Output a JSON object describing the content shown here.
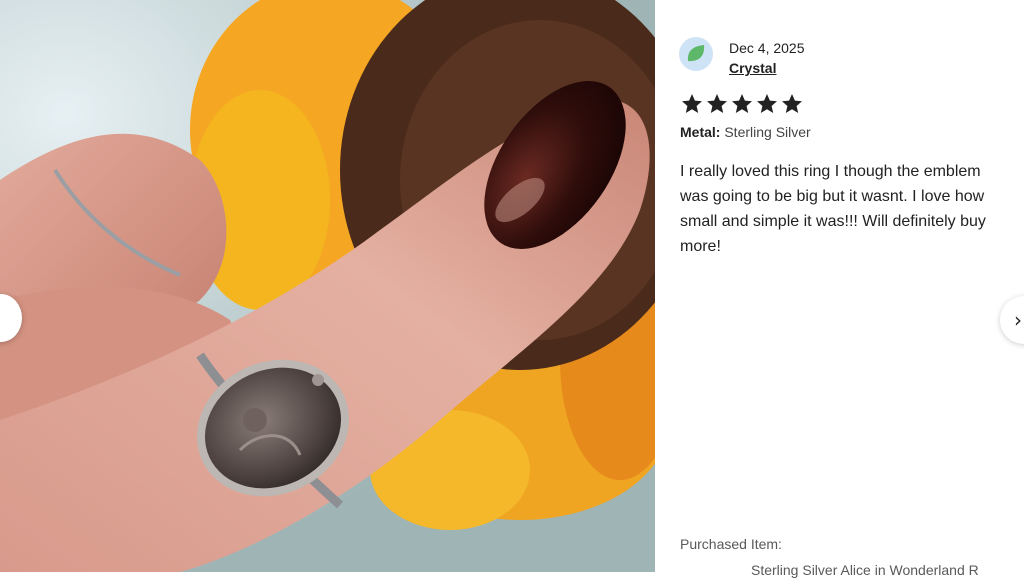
{
  "review": {
    "date": "Dec 4, 2025",
    "reviewer_name": "Crystal",
    "rating": 5,
    "rating_max": 5,
    "metal_label": "Metal:",
    "metal_value": "Sterling Silver",
    "text": "I really loved this ring I though the emblem was going to be big but it wasnt. I love how small and simple it was!!! Will definitely buy more!"
  },
  "purchased": {
    "label": "Purchased Item:",
    "item_name": "Sterling Silver Alice in Wonderland R"
  },
  "navigation": {
    "next_glyph": "›"
  },
  "icons": {
    "star": "star-icon",
    "avatar": "avatar-icon",
    "chevron_right": "chevron-right-icon"
  },
  "colors": {
    "star": "#222222",
    "avatar_bg": "#cfe3f6",
    "avatar_leaf": "#5db86a",
    "text": "#222222",
    "muted": "#595959"
  }
}
